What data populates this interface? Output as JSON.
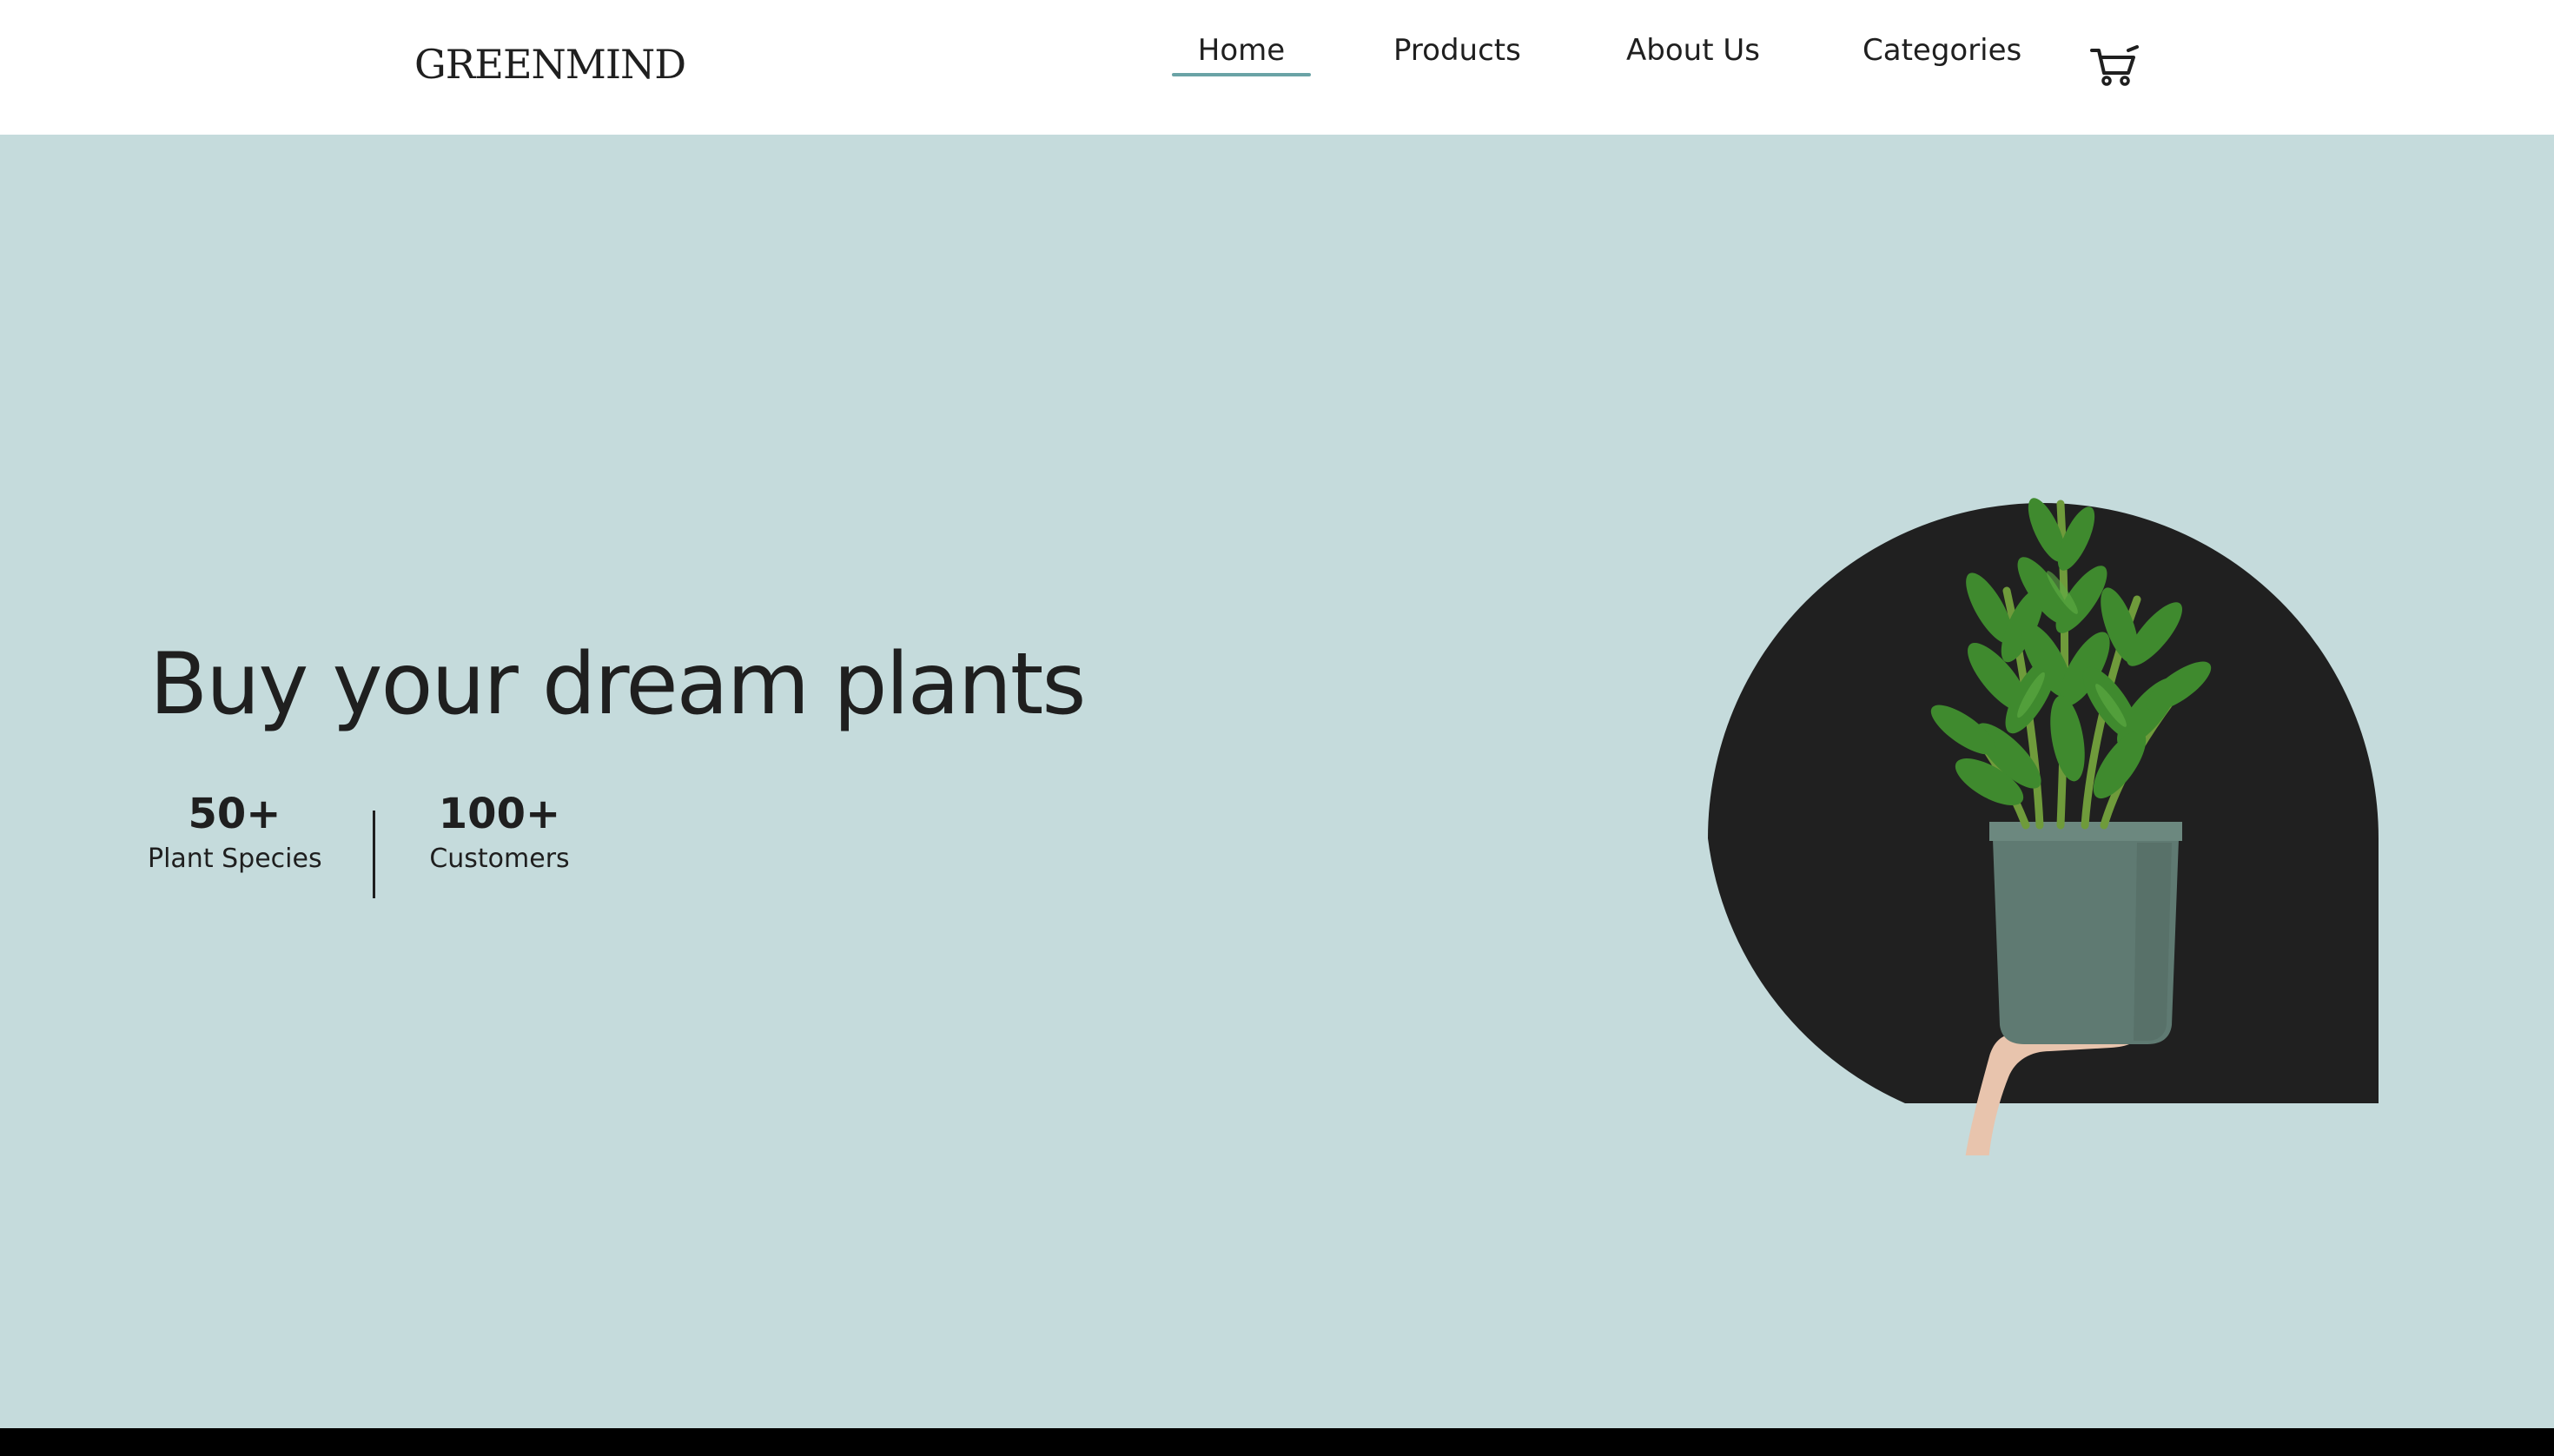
{
  "brand": {
    "logo_text": "GREENMIND"
  },
  "nav": {
    "items": [
      {
        "label": "Home",
        "active": true
      },
      {
        "label": "Products",
        "active": false
      },
      {
        "label": "About Us",
        "active": false
      },
      {
        "label": "Categories",
        "active": false
      }
    ],
    "cart_icon": "shopping-cart-icon"
  },
  "hero": {
    "title": "Buy your dream plants",
    "stats": [
      {
        "value": "50+",
        "label": "Plant Species"
      },
      {
        "value": "100+",
        "label": "Customers"
      }
    ],
    "image": "potted-plant-in-hand-image"
  },
  "colors": {
    "header_bg": "#ffffff",
    "hero_bg": "#c5dbdc",
    "accent": "#6aa3a6",
    "text": "#1f1f1f",
    "arch": "#202020",
    "pot": "#5f7a72",
    "leaf": "#3f8a2e",
    "frame": "#000000"
  }
}
